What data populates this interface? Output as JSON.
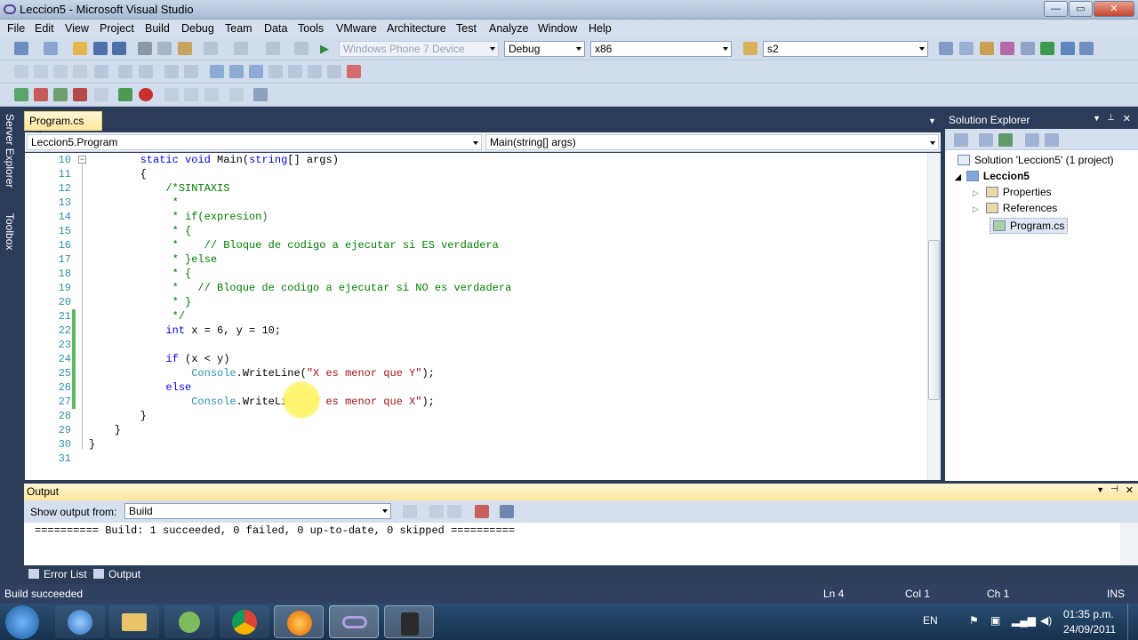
{
  "window": {
    "title": "Leccion5 - Microsoft Visual Studio",
    "min": "—",
    "max": "▭",
    "close": "✕"
  },
  "menu": [
    "File",
    "Edit",
    "View",
    "Project",
    "Build",
    "Debug",
    "Team",
    "Data",
    "Tools",
    "VMware",
    "Architecture",
    "Test",
    "Analyze",
    "Window",
    "Help"
  ],
  "toolbar": {
    "device": "Windows Phone 7 Device",
    "config": "Debug",
    "platform": "x86",
    "find": "s2"
  },
  "left_tabs": [
    "Server Explorer",
    "Toolbox"
  ],
  "doc_tab": {
    "label": "Program.cs",
    "close": "✕"
  },
  "nav": {
    "class_combo": "Leccion5.Program",
    "member_combo": "Main(string[] args)"
  },
  "code_lines": [
    {
      "n": "10",
      "text": "        static void Main(string[] args)"
    },
    {
      "n": "11",
      "text": "        {"
    },
    {
      "n": "12",
      "text": "            /*SINTAXIS"
    },
    {
      "n": "13",
      "text": "             *"
    },
    {
      "n": "14",
      "text": "             * if(expresion)"
    },
    {
      "n": "15",
      "text": "             * {"
    },
    {
      "n": "16",
      "text": "             *    // Bloque de codigo a ejecutar si ES verdadera"
    },
    {
      "n": "17",
      "text": "             * }else"
    },
    {
      "n": "18",
      "text": "             * {"
    },
    {
      "n": "19",
      "text": "             *   // Bloque de codigo a ejecutar si NO es verdadera"
    },
    {
      "n": "20",
      "text": "             * }"
    },
    {
      "n": "21",
      "text": "             */"
    },
    {
      "n": "22",
      "text": "            int x = 6, y = 10;"
    },
    {
      "n": "23",
      "text": ""
    },
    {
      "n": "24",
      "text": "            if (x < y)"
    },
    {
      "n": "25",
      "text": "                Console.WriteLine(\"X es menor que Y\");"
    },
    {
      "n": "26",
      "text": "            else"
    },
    {
      "n": "27",
      "text": "                Console.WriteLine(\"Y es menor que X\");"
    },
    {
      "n": "28",
      "text": "        }"
    },
    {
      "n": "29",
      "text": "    }"
    },
    {
      "n": "30",
      "text": "}"
    },
    {
      "n": "31",
      "text": ""
    }
  ],
  "solution_explorer": {
    "title": "Solution Explorer",
    "solution": "Solution 'Leccion5' (1 project)",
    "project": "Leccion5",
    "items": [
      "Properties",
      "References",
      "Program.cs"
    ]
  },
  "output": {
    "title": "Output",
    "show_from_label": "Show output from:",
    "show_from_value": "Build",
    "text": "========== Build: 1 succeeded, 0 failed, 0 up-to-date, 0 skipped =========="
  },
  "bottom_tabs": [
    "Error List",
    "Output"
  ],
  "status": {
    "message": "Build succeeded",
    "ln": "Ln 4",
    "col": "Col 1",
    "ch": "Ch 1",
    "mode": "INS"
  },
  "taskbar": {
    "lang": "EN",
    "time": "01:35 p.m.",
    "date": "24/09/2011"
  }
}
